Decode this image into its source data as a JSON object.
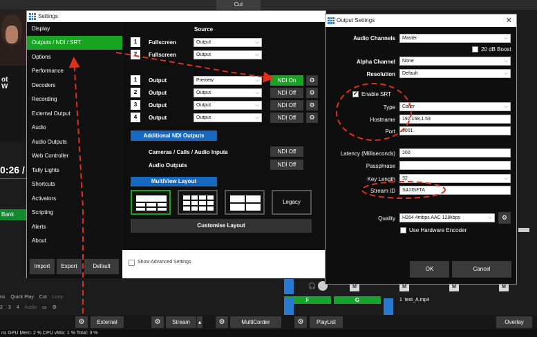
{
  "background": {
    "top_label": "Cut",
    "shirt_text": "ot\nW",
    "time_text": "0:26 /",
    "bank_label": "Bank",
    "left_tabs": [
      "ns",
      "Quick Play",
      "Cut",
      "Loop"
    ],
    "left_nums": [
      "2",
      "3",
      "4",
      "Audio"
    ],
    "bottom_bar": {
      "external": "External",
      "stream": "Stream",
      "stream_arrow": "▴",
      "multicorder": "MultiCorder",
      "playlist": "PlayList",
      "overlay": "Overlay"
    },
    "status": "ns  GPU Mem:  2 %   CPU vMix:  1 %   Total:  3 %",
    "mixer": {
      "m_label": "M",
      "g_labels": [
        "F",
        "G"
      ],
      "track_num": "1",
      "track_name": "test_A.mp4"
    }
  },
  "settings": {
    "title": "Settings",
    "nav": [
      "Display",
      "Outputs / NDI / SRT",
      "Options",
      "Performance",
      "Decoders",
      "Recording",
      "External Output",
      "Audio",
      "Audio Outputs",
      "Web Controller",
      "Tally Lights",
      "Shortcuts",
      "Activators",
      "Scripting",
      "Alerts",
      "About"
    ],
    "active_nav": 1,
    "buttons": {
      "import": "Import",
      "export": "Export",
      "default": "Default"
    },
    "source_header": "Source",
    "fullscreen": [
      {
        "num": "1",
        "label": "Fullscreen",
        "source": "Output"
      },
      {
        "num": "2",
        "label": "Fullscreen",
        "source": "Output"
      }
    ],
    "outputs": [
      {
        "num": "1",
        "label": "Output",
        "source": "Preview",
        "ndi": "NDI On"
      },
      {
        "num": "2",
        "label": "Output",
        "source": "Output",
        "ndi": "NDI Off"
      },
      {
        "num": "3",
        "label": "Output",
        "source": "Output",
        "ndi": "NDI Off"
      },
      {
        "num": "4",
        "label": "Output",
        "source": "Output",
        "ndi": "NDI Off"
      }
    ],
    "additional_ndi": "Additional NDI Outputs",
    "cameras_label": "Cameras / Calls / Audio Inputs",
    "cameras_ndi": "NDI Off",
    "audio_outputs_label": "Audio Outputs",
    "audio_outputs_ndi": "NDI Off",
    "multiview": "MultiView Layout",
    "legacy": "Legacy",
    "customise": "Customise Layout",
    "show_advanced": "Show Advanced Settings"
  },
  "output_settings": {
    "title": "Output Settings",
    "close": "✕",
    "audio_channels_label": "Audio Channels",
    "audio_channels_value": "Master",
    "boost_label": "20 dB Boost",
    "alpha_label": "Alpha Channel",
    "alpha_value": "None",
    "resolution_label": "Resolution",
    "resolution_value": "Default",
    "enable_srt_label": "Enable SRT",
    "type_label": "Type",
    "type_value": "Caller",
    "hostname_label": "Hostname",
    "hostname_value": "192.168.1.53",
    "port_label": "Port",
    "port_value": "9001",
    "latency_label": "Latency (Milliseconds)",
    "latency_value": "200",
    "passphrase_label": "Passphrase",
    "passphrase_value": "",
    "keylength_label": "Key Length",
    "keylength_value": "32",
    "streamid_label": "Stream ID",
    "streamid_value": "S4JJSFTA",
    "quality_label": "Quality",
    "quality_value": "H264 4mbps AAC 128kbps",
    "hw_encoder_label": "Use Hardware Encoder",
    "ok": "OK",
    "cancel": "Cancel"
  },
  "icons": {
    "gear": "⚙",
    "caret": "⌵"
  },
  "colors": {
    "accent_green": "#18a524",
    "blue": "#1669c1",
    "annotation_red": "#e0301e"
  }
}
